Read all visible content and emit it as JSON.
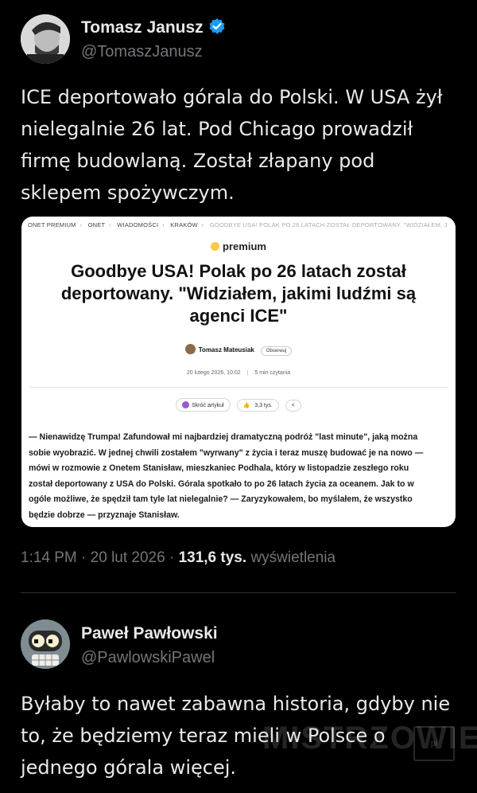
{
  "tweet1": {
    "name": "Tomasz Janusz",
    "handle": "@TomaszJanusz",
    "text_lines": [
      "ICE deportowało górala do Polski. W USA żył",
      "nielegalnie 26 lat. Pod Chicago prowadził",
      "firmę budowlaną. Został złapany pod",
      "sklepem spożywczym."
    ],
    "time": "1:14 PM",
    "date": "20 lut 2026",
    "views_count": "131,6 tys.",
    "views_label": "wyświetlenia"
  },
  "article": {
    "breadcrumbs": [
      "ONET PREMIUM",
      "ONET",
      "WIADOMOŚCI",
      "KRAKÓW"
    ],
    "breadcrumb_last": "GOODBYE USA! POLAK PO 26 LATACH ZOSTAŁ DEPORTOWANY. \"WIDZIAŁEM, J",
    "badge": "premium",
    "headline_lines": [
      "Goodbye USA! Polak po 26 latach został",
      "deportowany. \"Widziałem, jakimi ludźmi są",
      "agenci ICE\""
    ],
    "author": "Tomasz Mateusiak",
    "follow_label": "Obserwuj",
    "date": "20 lutego 2026, 10:02",
    "read_time": "5 min czytania",
    "summary_label": "Skróć artykuł",
    "likes": "3,3 tys.",
    "body_lines": [
      "— Nienawidzę Trumpa! Zafundował mi najbardziej dramatyczną podróż \"last minute\", jaką można",
      "sobie wyobrazić. W jednej chwili zostałem \"wyrwany\" z życia i teraz muszę budować je na nowo —",
      "mówi w rozmowie z Onetem Stanisław, mieszkaniec Podhala, który w listopadzie zeszłego roku",
      "został deportowany z USA do Polski. Górala spotkało to po 26 latach życia za oceanem. Jak to w",
      "ogóle możliwe, że spędził tam tyle lat nielegalnie? — Zaryzykowałem, bo myślałem, że wszystko",
      "będzie dobrze — przyznaje Stanisław."
    ]
  },
  "tweet2": {
    "name": "Paweł Pawłowski",
    "handle": "@PawlowskiPawel",
    "text_lines": [
      "Byłaby to nawet zabawna historia, gdyby nie",
      "to, że będziemy teraz mieli w Polsce o",
      "jednego górala więcej."
    ]
  },
  "watermark": {
    "text": "MISTRZOWIE",
    "box": "pl"
  },
  "colors": {
    "background": "#000000",
    "text": "#e7e9ea",
    "muted": "#71767b",
    "verified": "#1d9bf0"
  }
}
